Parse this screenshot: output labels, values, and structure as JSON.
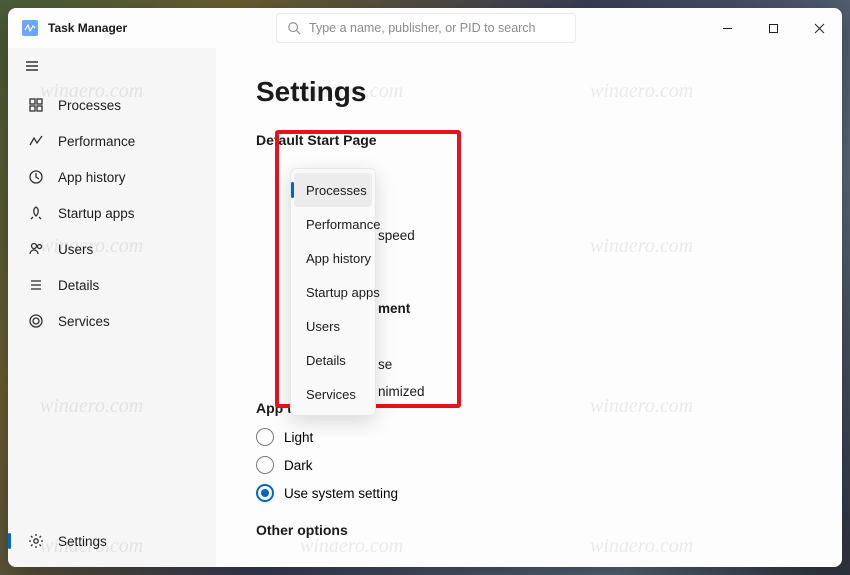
{
  "app": {
    "title": "Task Manager"
  },
  "search": {
    "placeholder": "Type a name, publisher, or PID to search"
  },
  "sidebar": {
    "items": [
      {
        "label": "Processes"
      },
      {
        "label": "Performance"
      },
      {
        "label": "App history"
      },
      {
        "label": "Startup apps"
      },
      {
        "label": "Users"
      },
      {
        "label": "Details"
      },
      {
        "label": "Services"
      }
    ],
    "footer": {
      "label": "Settings"
    }
  },
  "page": {
    "title": "Settings",
    "sections": {
      "default_start": {
        "title": "Default Start Page"
      },
      "update_speed": {
        "peek_label": "speed"
      },
      "window_mgmt": {
        "peek_label": "ment",
        "opt1_peek": "se",
        "opt2_peek": "nimized"
      },
      "app_theme": {
        "title": "App theme",
        "options": [
          {
            "label": "Light",
            "checked": false
          },
          {
            "label": "Dark",
            "checked": false
          },
          {
            "label": "Use system setting",
            "checked": true
          }
        ]
      },
      "other_options": {
        "title": "Other options"
      }
    }
  },
  "dropdown": {
    "selected_index": 0,
    "items": [
      "Processes",
      "Performance",
      "App history",
      "Startup apps",
      "Users",
      "Details",
      "Services"
    ]
  },
  "watermark_text": "winaero.com",
  "colors": {
    "accent": "#0067c0",
    "highlight_border": "#e8131a"
  }
}
